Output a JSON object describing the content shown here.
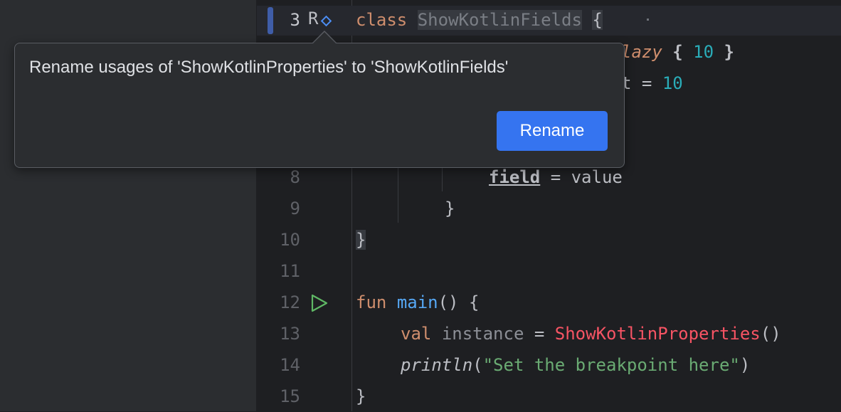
{
  "popup": {
    "message": "Rename usages of 'ShowKotlinProperties' to 'ShowKotlinFields'",
    "button_label": "Rename"
  },
  "gutter": {
    "rename_glyph": "R",
    "line_numbers": [
      "3",
      "8",
      "9",
      "10",
      "11",
      "12",
      "13",
      "14",
      "15"
    ]
  },
  "code": {
    "line3": {
      "kw": "class",
      "name": "ShowKotlinFields",
      "brace": "{"
    },
    "line4_partial": {
      "kw": "lazy",
      "open": "{",
      "num": "10",
      "close": "}"
    },
    "line5_partial": {
      "text": "t =",
      "num": "10"
    },
    "line8": {
      "field": "field",
      "rest": " = value"
    },
    "line9": "}",
    "line10": "}",
    "line12": {
      "kw": "fun",
      "fn": "main",
      "rest": "() {"
    },
    "line13": {
      "kw": "val",
      "var": "instance",
      "eq": " = ",
      "ref": "ShowKotlinProperties",
      "call": "()"
    },
    "line14": {
      "fn": "println",
      "open": "(",
      "str": "\"Set the breakpoint here\"",
      "close": ")"
    },
    "line15": "}"
  },
  "colors": {
    "accent_button": "#3574f0",
    "vcs_marker": "#3f5da8",
    "keyword": "#cf8e6d",
    "number": "#2aacb8",
    "function": "#56a8f5",
    "error_reference": "#f75464",
    "string": "#6aab73",
    "run_icon": "#5fb865"
  }
}
